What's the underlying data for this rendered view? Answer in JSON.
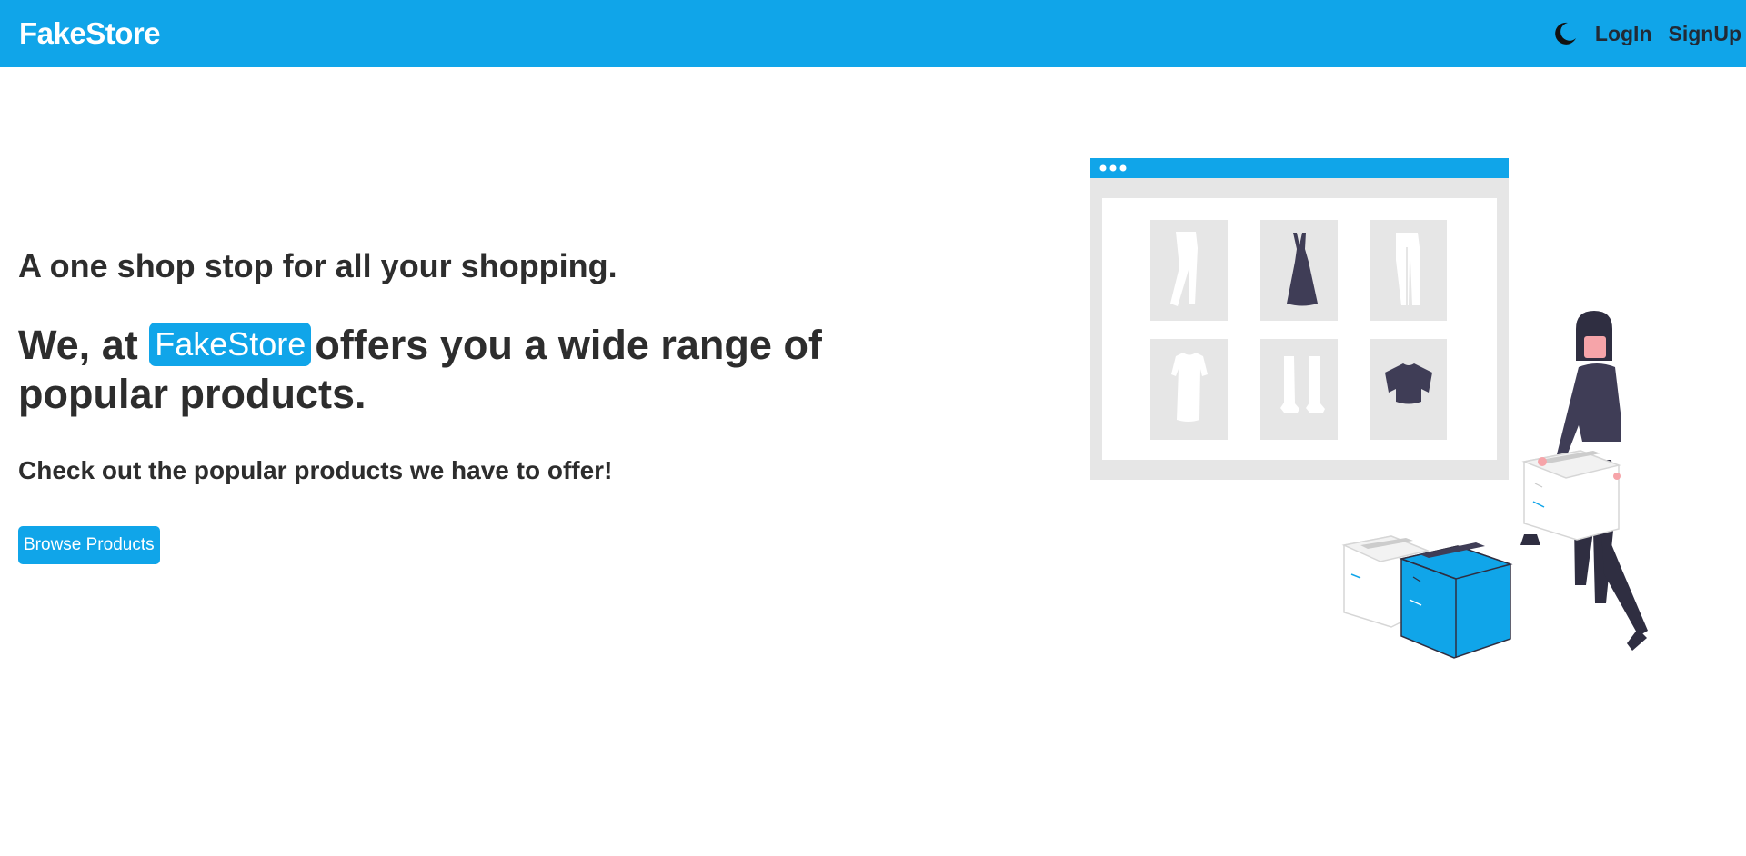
{
  "navbar": {
    "brand": "FakeStore",
    "theme_toggle_icon": "moon-icon",
    "login_label": "LogIn",
    "signup_label": "SignUp"
  },
  "hero": {
    "tagline": "A one shop stop for all your shopping.",
    "headline_prefix": "We, at",
    "headline_brand": "FakeStore",
    "headline_suffix": "offers you a wide range of popular products.",
    "subline": "Check out the popular products we have to offer!",
    "cta_label": "Browse Products"
  },
  "illustration": {
    "subject": "shopping-illustration",
    "products": [
      "pants-icon",
      "dress-icon",
      "trousers-icon",
      "tshirt-icon",
      "boots-icon",
      "shirt-icon"
    ]
  },
  "colors": {
    "accent": "#10a5e9",
    "text": "#2d2d2d",
    "nav_link": "#222a35",
    "illustration_dark": "#3f3d56",
    "illustration_gray": "#e6e6e6"
  }
}
